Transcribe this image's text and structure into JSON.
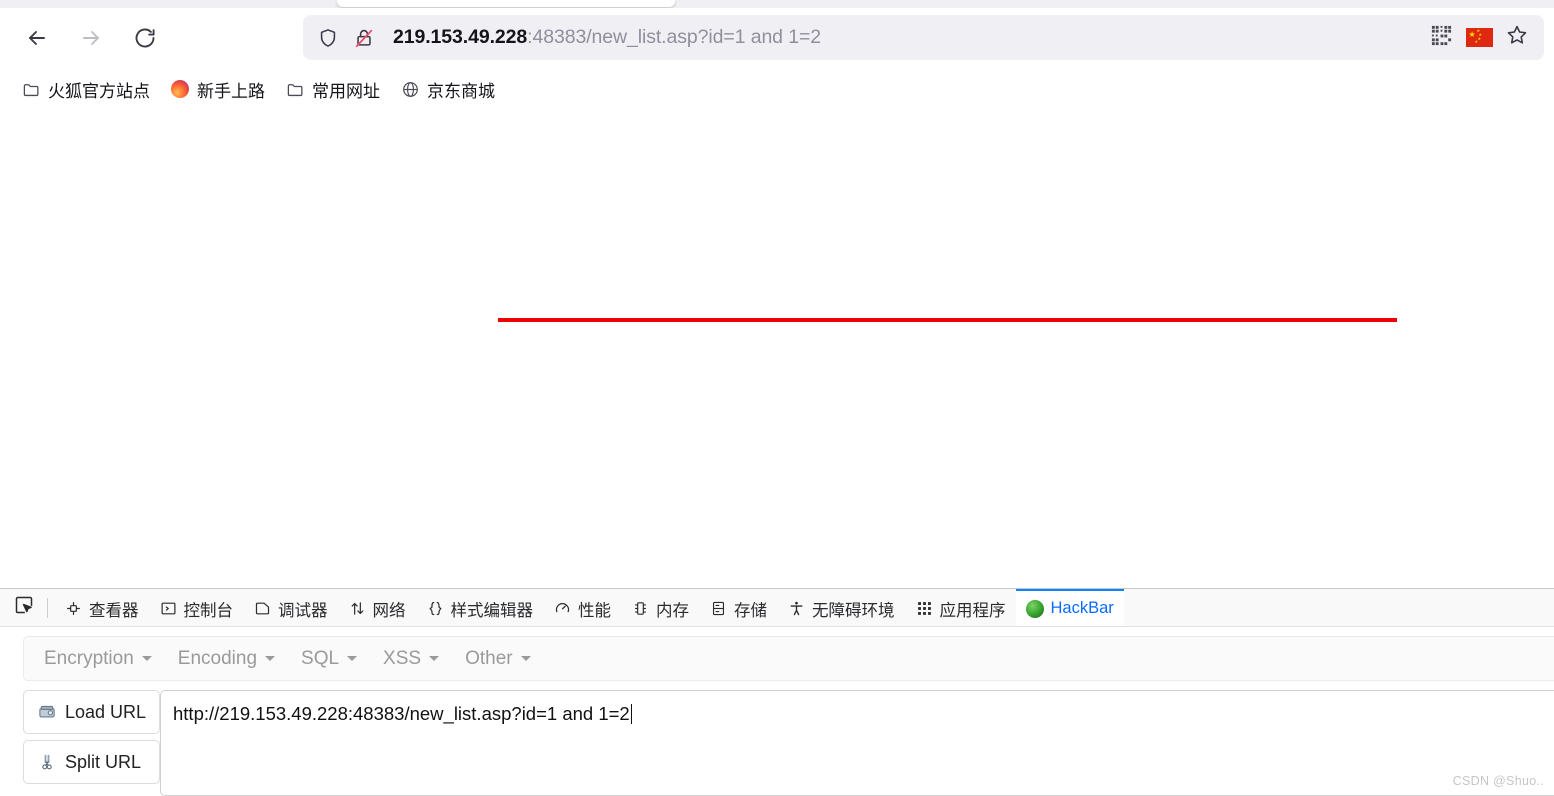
{
  "browser": {
    "nav": {
      "back_label": "Back",
      "forward_label": "Forward",
      "reload_label": "Reload"
    },
    "address_bar": {
      "host": "219.153.49.228",
      "path": ":48383/new_list.asp?id=1 and 1=2",
      "full_url": "219.153.49.228:48383/new_list.asp?id=1 and 1=2",
      "shield_icon": "shield-icon",
      "lock_icon": "lock-crossed-icon",
      "actions": [
        {
          "name": "qr-code-icon",
          "label": "QR Code"
        },
        {
          "name": "china-flag-icon",
          "label": "Language"
        },
        {
          "name": "star-icon",
          "label": "Bookmark"
        }
      ]
    },
    "bookmarks": [
      {
        "label": "火狐官方站点",
        "icon": "folder-icon"
      },
      {
        "label": "新手上路",
        "icon": "firefox-logo-icon"
      },
      {
        "label": "常用网址",
        "icon": "folder-icon"
      },
      {
        "label": "京东商城",
        "icon": "globe-icon"
      }
    ]
  },
  "page": {
    "rule_color": "#f20000"
  },
  "devtools": {
    "picker_icon": "element-picker-icon",
    "tabs": [
      {
        "label": "查看器",
        "icon": "inspector-icon",
        "active": false
      },
      {
        "label": "控制台",
        "icon": "console-icon",
        "active": false
      },
      {
        "label": "调试器",
        "icon": "debugger-icon",
        "active": false
      },
      {
        "label": "网络",
        "icon": "network-icon",
        "active": false
      },
      {
        "label": "样式编辑器",
        "icon": "style-editor-icon",
        "active": false
      },
      {
        "label": "性能",
        "icon": "performance-icon",
        "active": false
      },
      {
        "label": "内存",
        "icon": "memory-icon",
        "active": false
      },
      {
        "label": "存储",
        "icon": "storage-icon",
        "active": false
      },
      {
        "label": "无障碍环境",
        "icon": "accessibility-icon",
        "active": false
      },
      {
        "label": "应用程序",
        "icon": "application-icon",
        "active": false
      },
      {
        "label": "HackBar",
        "icon": "hackbar-globe-icon",
        "active": true
      }
    ],
    "active_tab_color": "#0a6cff"
  },
  "hackbar": {
    "menus": [
      {
        "label": "Encryption"
      },
      {
        "label": "Encoding"
      },
      {
        "label": "SQL"
      },
      {
        "label": "XSS"
      },
      {
        "label": "Other"
      }
    ],
    "buttons": [
      {
        "label": "Load URL",
        "icon": "load-url-icon"
      },
      {
        "label": "Split URL",
        "icon": "scissors-icon"
      }
    ],
    "url_field": {
      "value": "http://219.153.49.228:48383/new_list.asp?id=1 and 1=2",
      "placeholder": ""
    }
  },
  "watermark": {
    "text": "CSDN @Shuo.."
  }
}
